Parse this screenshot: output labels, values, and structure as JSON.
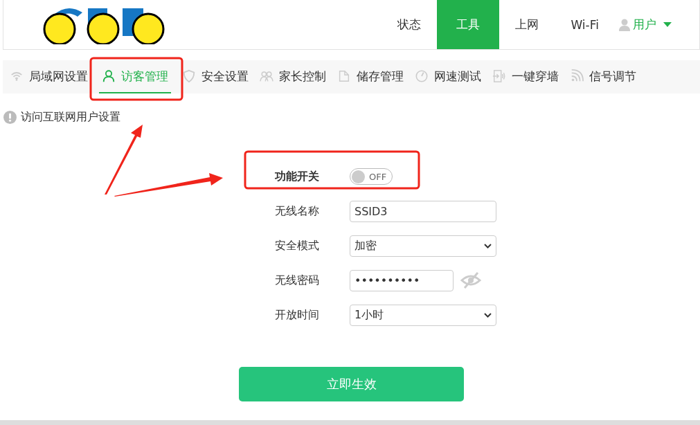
{
  "header": {
    "nav": [
      {
        "label": "状态",
        "selected": false
      },
      {
        "label": "工具",
        "selected": true
      },
      {
        "label": "上网",
        "selected": false
      },
      {
        "label": "Wi-Fi",
        "selected": false
      }
    ],
    "user_menu": {
      "label": "用户"
    }
  },
  "subnav": [
    {
      "label": "局域网设置",
      "selected": false
    },
    {
      "label": "访客管理",
      "selected": true
    },
    {
      "label": "安全设置",
      "selected": false
    },
    {
      "label": "家长控制",
      "selected": false
    },
    {
      "label": "储存管理",
      "selected": false
    },
    {
      "label": "网速测试",
      "selected": false
    },
    {
      "label": "一键穿墙",
      "selected": false
    },
    {
      "label": "信号调节",
      "selected": false
    }
  ],
  "notice": "访问互联网用户设置",
  "form": {
    "fields": [
      {
        "kind": "switch",
        "label": "功能开关",
        "on": false,
        "state_text": "OFF"
      },
      {
        "kind": "text",
        "label": "无线名称",
        "value": "SSID3"
      },
      {
        "kind": "select",
        "label": "安全模式",
        "value": "加密"
      },
      {
        "kind": "password",
        "label": "无线密码",
        "value": "••••••••••"
      },
      {
        "kind": "select",
        "label": "开放时间",
        "value": "1小时"
      }
    ]
  },
  "submit": "立即生效"
}
